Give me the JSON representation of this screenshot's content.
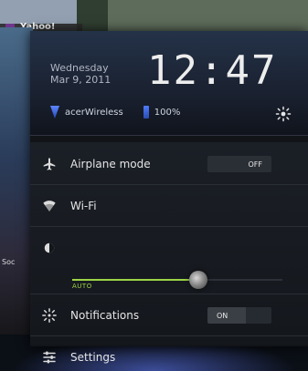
{
  "background": {
    "top_app_label": "Yahoo!",
    "left_app_label": "Soc"
  },
  "clock": {
    "weekday": "Wednesday",
    "date": "Mar 9, 2011",
    "time": "12:47"
  },
  "status": {
    "network_name": "acerWireless",
    "battery": "100%"
  },
  "quick_settings": {
    "airplane_label": "Airplane mode",
    "airplane_state": "OFF",
    "wifi_label": "Wi-Fi",
    "brightness_auto": "AUTO",
    "brightness_level": 0.6,
    "notifications_label": "Notifications",
    "notifications_state": "ON",
    "settings_label": "Settings"
  },
  "colors": {
    "accent_green": "#9dd447",
    "accent_blue": "#4f7cff"
  },
  "icons": {
    "airplane": "airplane-icon",
    "wifi": "wifi-icon",
    "brightness": "brightness-icon",
    "notifications": "notifications-icon",
    "settings": "settings-icon",
    "brightness_top": "brightness-icon",
    "wifi_mini": "wifi-icon",
    "battery": "battery-icon"
  }
}
